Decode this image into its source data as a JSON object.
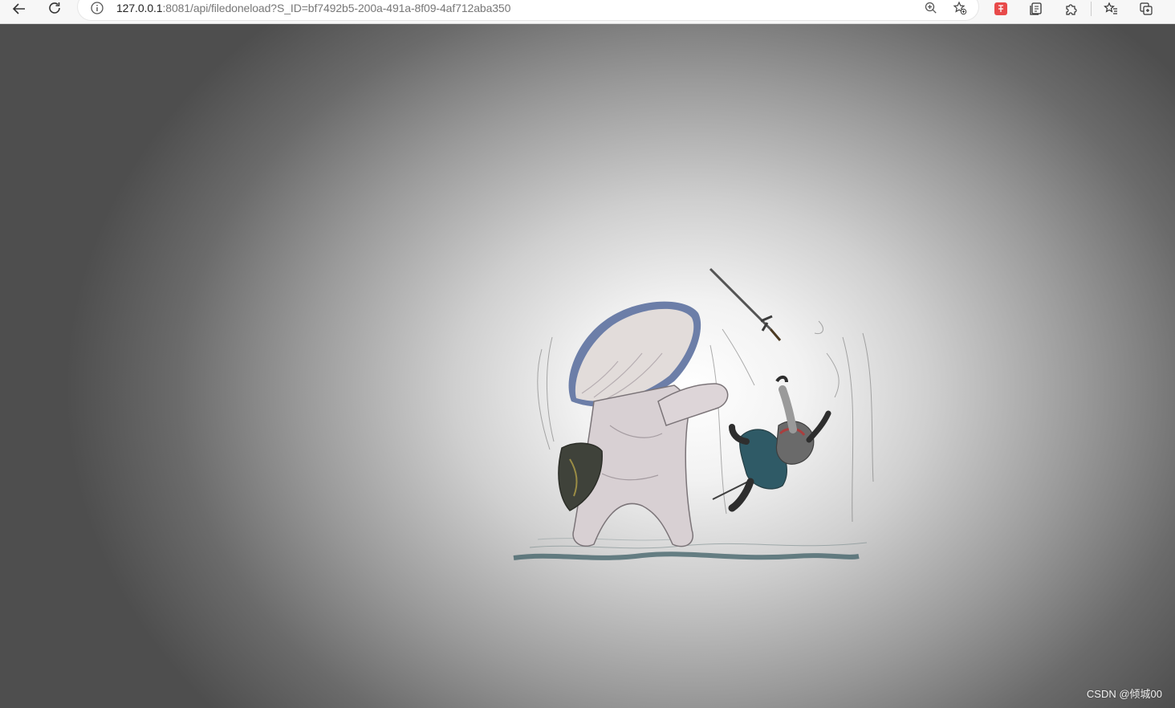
{
  "browser": {
    "address_bar": {
      "host": "127.0.0.1",
      "rest": ":8081/api/filedoneload?S_ID=bf7492b5-200a-491a-8f09-4af712aba350"
    },
    "icons": {
      "back": "back-arrow-icon",
      "reload": "reload-icon",
      "site_info": "info-icon",
      "zoom": "zoom-in-icon",
      "favorite_add": "star-add-icon",
      "extension_red": "extension-badge-icon",
      "collections": "collections-icon",
      "extensions": "puzzle-icon",
      "favorites": "favorites-icon",
      "tab_actions": "tab-actions-icon"
    },
    "extension_badge_color": "#e84a4a"
  },
  "viewer": {
    "image": {
      "subject": "mushroom"
    },
    "watermark": "CSDN @倾城00"
  }
}
